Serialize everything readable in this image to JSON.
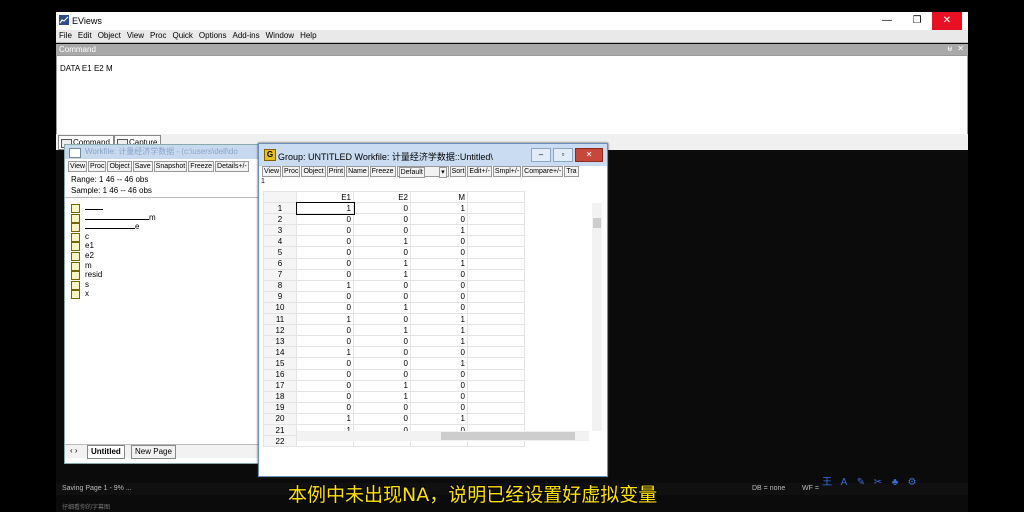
{
  "app": {
    "title": "EViews",
    "controls": {
      "min": "—",
      "max": "❐",
      "close": "✕"
    }
  },
  "menu": [
    "File",
    "Edit",
    "Object",
    "View",
    "Proc",
    "Quick",
    "Options",
    "Add-ins",
    "Window",
    "Help"
  ],
  "command": {
    "header": "Command",
    "pin": "ᵾ",
    "close": "✕",
    "text": "DATA E1 E2 M",
    "tabs": {
      "command": "Command",
      "capture": "Capture"
    }
  },
  "workfile": {
    "title": "Workfile: 计量经济学数据 - (c:\\users\\dell\\do",
    "buttons": [
      "View",
      "Proc",
      "Object",
      "Save",
      "Snapshot",
      "Freeze",
      "Details+/-"
    ],
    "range": "Range:  1 46   --   46 obs",
    "sample": "Sample: 1 46   --   46 obs",
    "objects": [
      "",
      "m",
      "e",
      "c",
      "e1",
      "e2",
      "m",
      "resid",
      "s",
      "x"
    ],
    "nav": "‹ ›",
    "tab_active": "Untitled",
    "tab_new": "New Page"
  },
  "group": {
    "title": "Group: UNTITLED   Workfile: 计量经济学数据::Untitled\\",
    "icon": "G",
    "buttons": [
      "View",
      "Proc",
      "Object",
      "Print",
      "Name",
      "Freeze"
    ],
    "select_value": "Default",
    "buttons2": [
      "Sort",
      "Edit+/-",
      "Smpl+/-",
      "Compare+/-",
      "Tra"
    ],
    "cell_ref": "1",
    "columns": [
      "E1",
      "E2",
      "M"
    ],
    "rows": [
      {
        "n": "1",
        "e1": "1",
        "e2": "0",
        "m": "1"
      },
      {
        "n": "2",
        "e1": "0",
        "e2": "0",
        "m": "0"
      },
      {
        "n": "3",
        "e1": "0",
        "e2": "0",
        "m": "1"
      },
      {
        "n": "4",
        "e1": "0",
        "e2": "1",
        "m": "0"
      },
      {
        "n": "5",
        "e1": "0",
        "e2": "0",
        "m": "0"
      },
      {
        "n": "6",
        "e1": "0",
        "e2": "1",
        "m": "1"
      },
      {
        "n": "7",
        "e1": "0",
        "e2": "1",
        "m": "0"
      },
      {
        "n": "8",
        "e1": "1",
        "e2": "0",
        "m": "0"
      },
      {
        "n": "9",
        "e1": "0",
        "e2": "0",
        "m": "0"
      },
      {
        "n": "10",
        "e1": "0",
        "e2": "1",
        "m": "0"
      },
      {
        "n": "11",
        "e1": "1",
        "e2": "0",
        "m": "1"
      },
      {
        "n": "12",
        "e1": "0",
        "e2": "1",
        "m": "1"
      },
      {
        "n": "13",
        "e1": "0",
        "e2": "0",
        "m": "1"
      },
      {
        "n": "14",
        "e1": "1",
        "e2": "0",
        "m": "0"
      },
      {
        "n": "15",
        "e1": "0",
        "e2": "0",
        "m": "1"
      },
      {
        "n": "16",
        "e1": "0",
        "e2": "0",
        "m": "0"
      },
      {
        "n": "17",
        "e1": "0",
        "e2": "1",
        "m": "0"
      },
      {
        "n": "18",
        "e1": "0",
        "e2": "1",
        "m": "0"
      },
      {
        "n": "19",
        "e1": "0",
        "e2": "0",
        "m": "0"
      },
      {
        "n": "20",
        "e1": "1",
        "e2": "0",
        "m": "1"
      },
      {
        "n": "21",
        "e1": "1",
        "e2": "0",
        "m": "0"
      },
      {
        "n": "22",
        "e1": "",
        "e2": "",
        "m": ""
      }
    ]
  },
  "status": {
    "left": "Saving Page 1 - 9% ...",
    "db": "DB = none",
    "wf": "WF ="
  },
  "subtitle": "本例中未出现NA，说明已经设置好虚拟变量",
  "bottom_text": "仔细看你的字幕图"
}
